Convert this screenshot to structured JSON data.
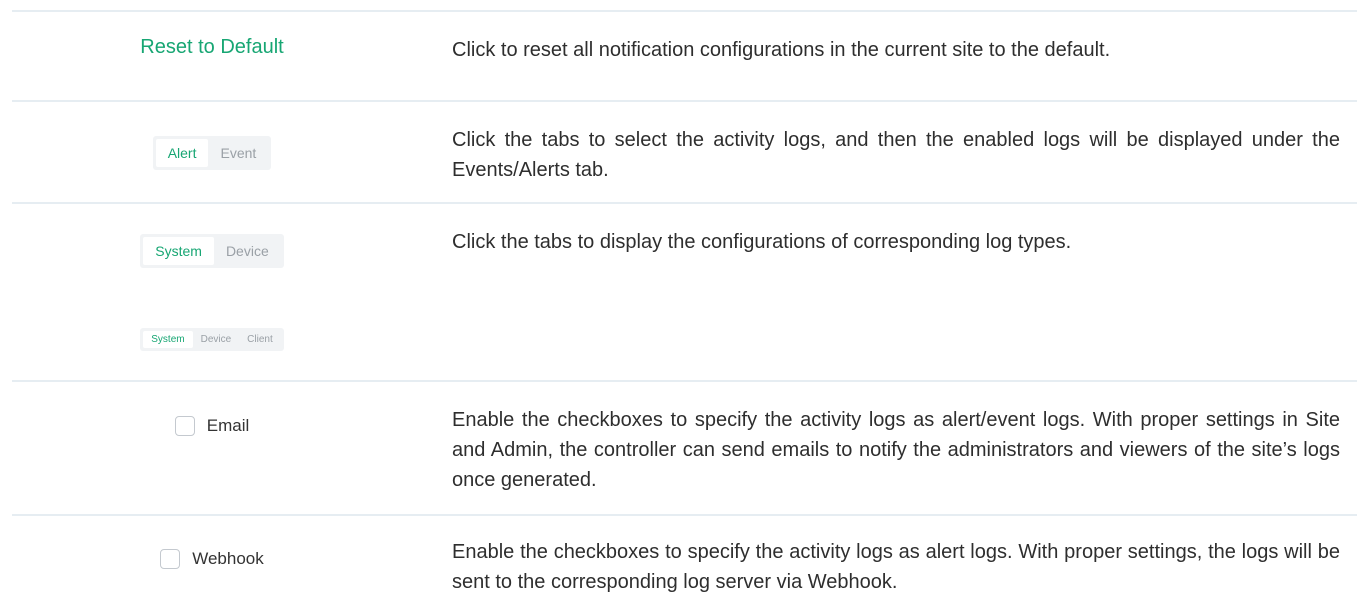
{
  "rows": [
    {
      "control": "Reset to Default",
      "description": "Click to reset all notification configurations in the current site to the default."
    },
    {
      "tabs": [
        "Alert",
        "Event"
      ],
      "description": "Click the tabs to select the activity logs, and then the enabled logs will be displayed under the Events/Alerts tab."
    },
    {
      "tabs_a": [
        "System",
        "Device"
      ],
      "tabs_b": [
        "System",
        "Device",
        "Client"
      ],
      "description": "Click the tabs to display the configurations of corresponding log types."
    },
    {
      "checkbox_label": "Email",
      "checked": false,
      "description": "Enable the checkboxes to specify the activity logs as alert/event logs. With proper settings in Site and Admin, the controller can send emails to notify the administrators and viewers of the site’s logs once generated."
    },
    {
      "checkbox_label": "Webhook",
      "checked": false,
      "description": "Enable the checkboxes to specify the activity logs as alert logs. With proper settings, the logs will be sent to the corresponding log server via Webhook."
    }
  ],
  "colors": {
    "accent": "#17a673",
    "inactive_tab": "#9aa0a6",
    "divider": "#e6edf2"
  }
}
